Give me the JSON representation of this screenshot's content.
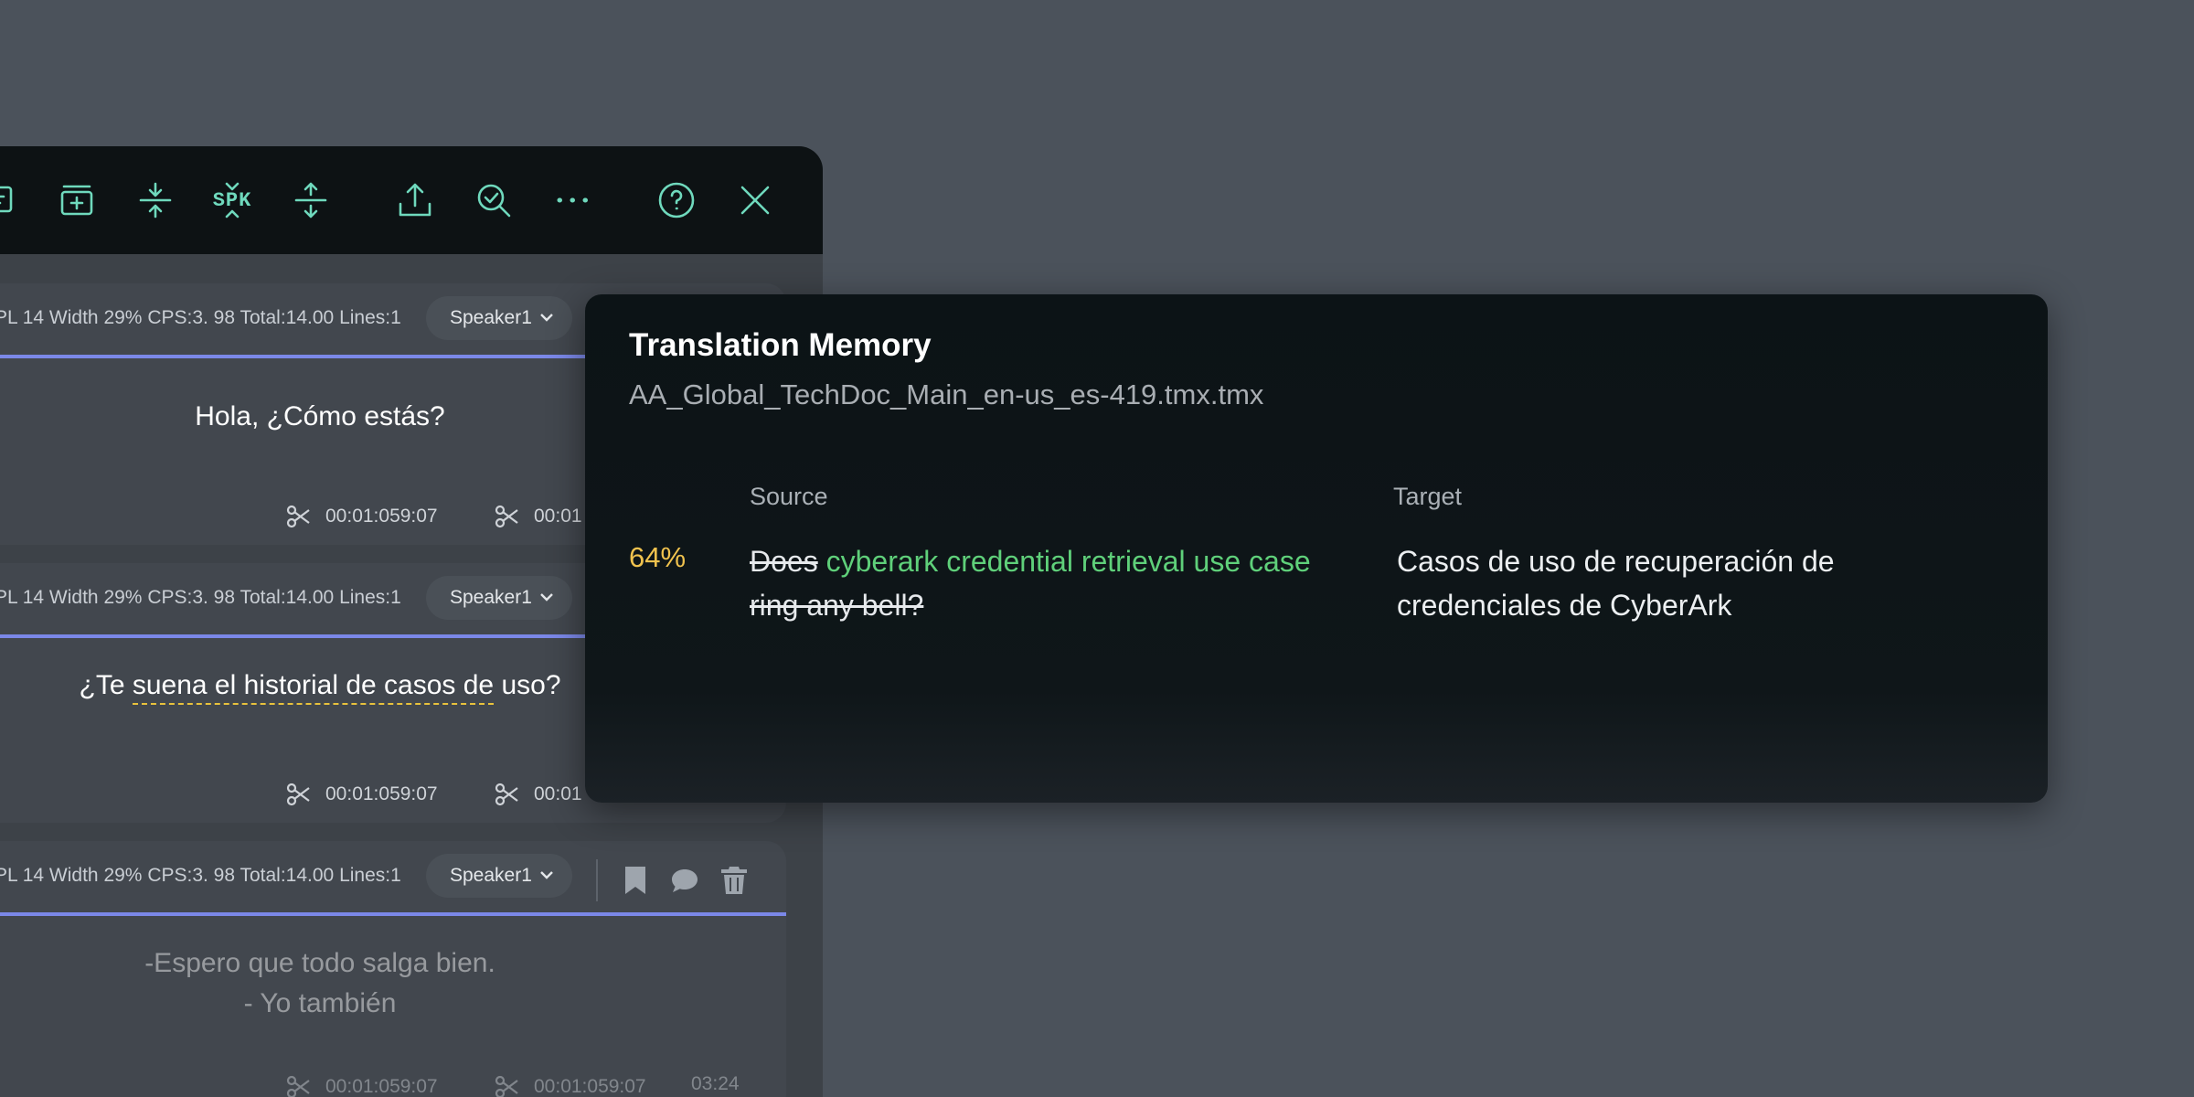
{
  "colors": {
    "background": "#4b525b",
    "toolbar": "#0d1214",
    "icon_accent": "#6fd9bd",
    "segment_divider": "#7b88e8",
    "match_green": "#5fd07a",
    "percent_yellow": "#f0c24e"
  },
  "toolbar": {
    "icons": [
      "subtitle-icon",
      "add-subtitle-icon",
      "merge-icon",
      "speaker-icon",
      "split-icon",
      "export-icon",
      "review-icon",
      "more-icon",
      "help-icon",
      "close-icon"
    ],
    "speaker_label": "SPK"
  },
  "segments": [
    {
      "stats": "PL 14 Width 29% CPS:3. 98 Total:14.00 Lines:1",
      "speaker": "Speaker1",
      "text": "Hola, ¿Cómo estás?",
      "time_in": "00:01:059:07",
      "time_out": "00:01"
    },
    {
      "stats": "PL 14 Width 29% CPS:3. 98 Total:14.00 Lines:1",
      "speaker": "Speaker1",
      "text_pre": "¿Te ",
      "text_underlined": "suena el historial de casos de",
      "text_post": " uso?",
      "time_in": "00:01:059:07",
      "time_out": "00:01"
    },
    {
      "stats": "PL 14 Width 29% CPS:3. 98 Total:14.00 Lines:1",
      "speaker": "Speaker1",
      "line1": "-Espero que todo salga bien.",
      "line2": "- Yo también",
      "time_in": "00:01:059:07",
      "time_out": "00:01:059:07",
      "duration": "03:24"
    }
  ],
  "translation_memory": {
    "title": "Translation Memory",
    "file": "AA_Global_TechDoc_Main_en-us_es-419.tmx.tmx",
    "source_header": "Source",
    "target_header": "Target",
    "match_percent": "64%",
    "source_deleted_1": "Does",
    "source_match": "cyberark credential retrieval use case",
    "source_deleted_2": "ring any bell?",
    "target": "Casos de uso de recuperación de credenciales de CyberArk"
  }
}
